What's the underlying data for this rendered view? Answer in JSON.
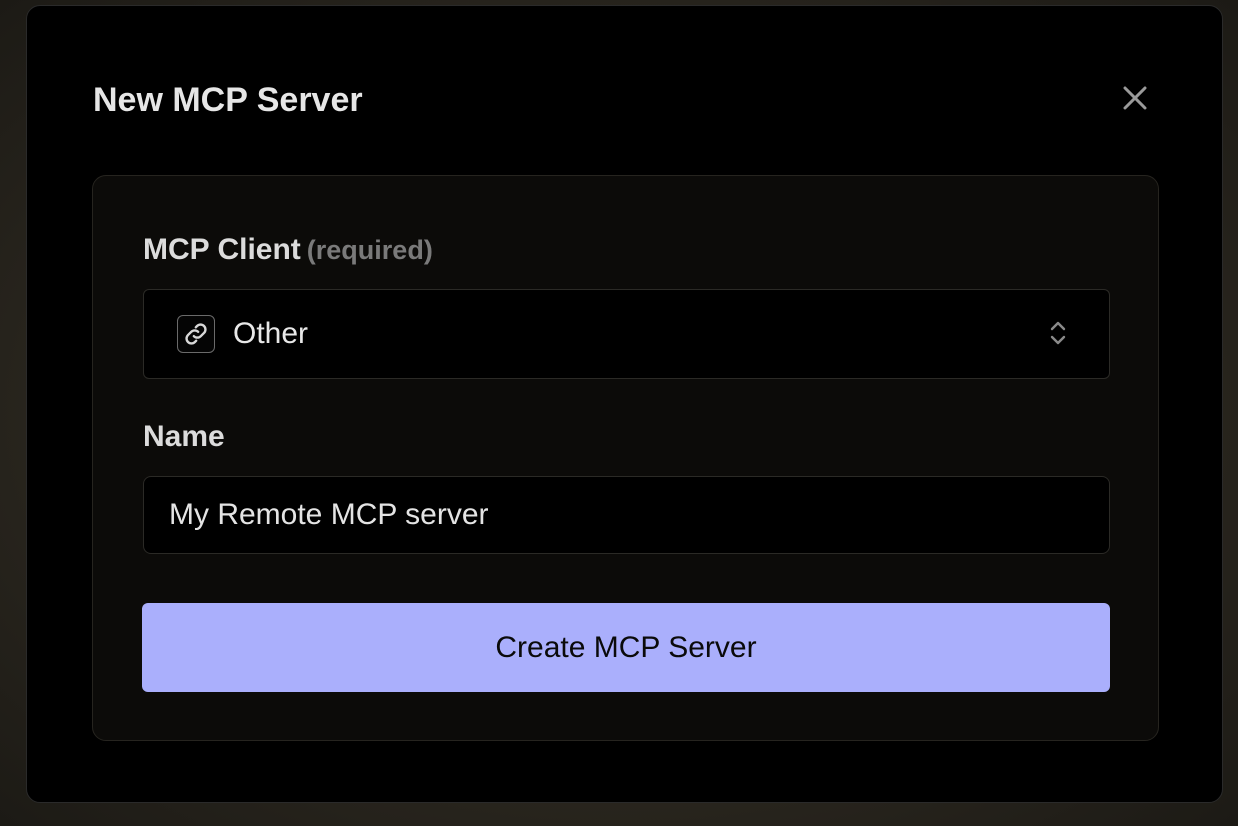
{
  "modal": {
    "title": "New MCP Server",
    "close_icon": "close-icon"
  },
  "form": {
    "client": {
      "label": "MCP Client",
      "required_text": "(required)",
      "selected_value": "Other",
      "option_icon": "link-icon",
      "select_icon": "chevron-up-down-icon"
    },
    "name": {
      "label": "Name",
      "value": "My Remote MCP server"
    },
    "submit_label": "Create MCP Server"
  },
  "colors": {
    "modal_bg": "#000000",
    "card_bg": "#0c0b09",
    "accent_button": "#aaaffc",
    "text_primary": "#e6e6e6",
    "text_muted": "#7a7a7a"
  }
}
